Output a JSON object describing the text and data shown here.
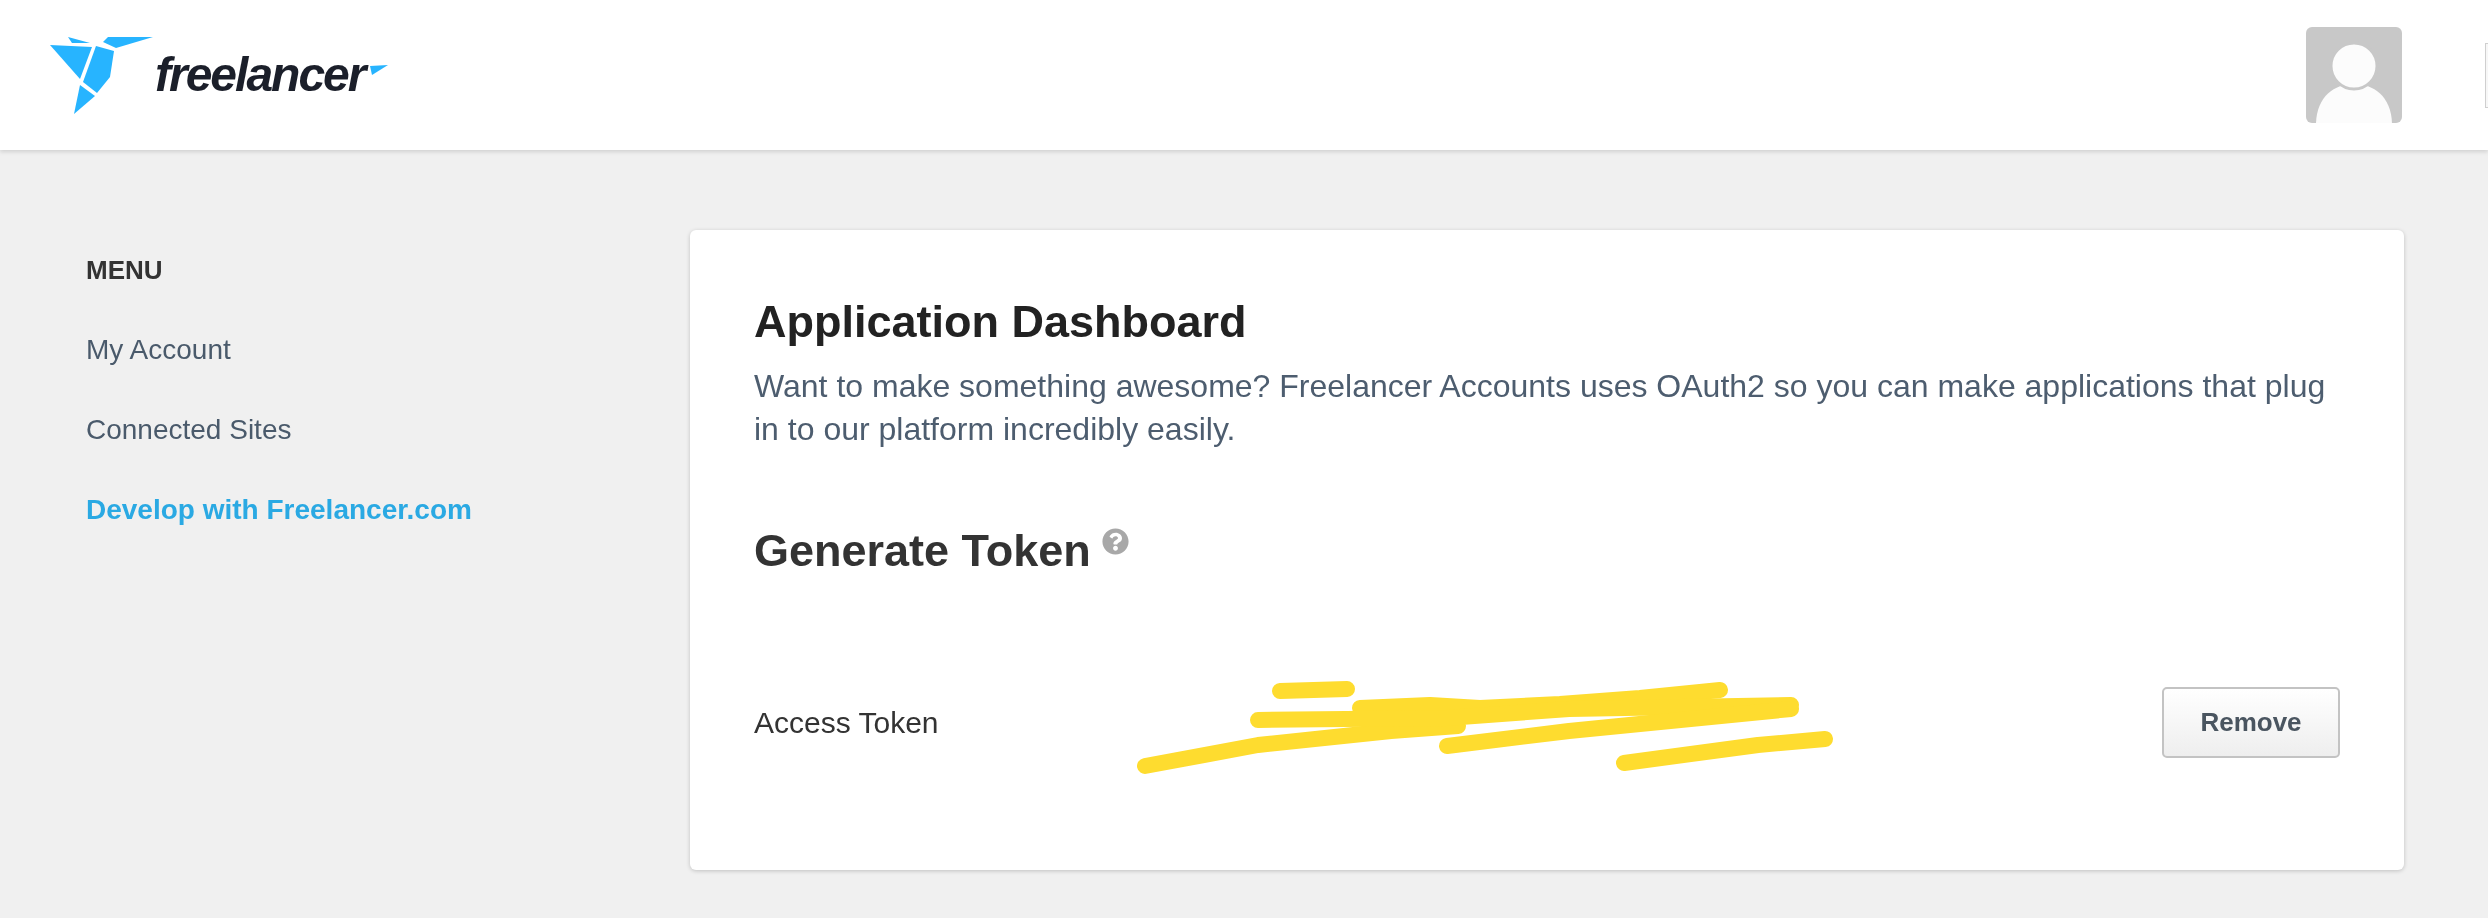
{
  "header": {
    "logo_text": "freelancer"
  },
  "sidebar": {
    "heading": "MENU",
    "items": [
      {
        "label": "My Account",
        "selected": false
      },
      {
        "label": "Connected Sites",
        "selected": false
      },
      {
        "label": "Develop with Freelancer.com",
        "selected": true
      }
    ]
  },
  "card": {
    "title": "Application Dashboard",
    "description": "Want to make something awesome? Freelancer Accounts uses OAuth2 so you can make applications that plug in to our platform incredibly easily.",
    "section_title": "Generate Token",
    "token_row": {
      "label": "Access Token",
      "button": "Remove"
    }
  }
}
